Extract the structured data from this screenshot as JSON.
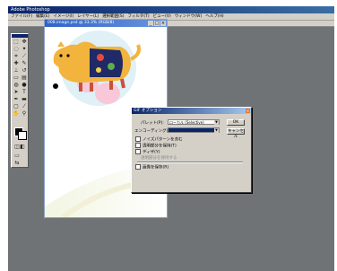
{
  "app": {
    "title": "Adobe Photoshop",
    "menu": [
      "ファイル(F)",
      "編集(E)",
      "イメージ(I)",
      "レイヤー(L)",
      "選択範囲(S)",
      "フィルタ(T)",
      "ビュー(V)",
      "ウィンドウ(W)",
      "ヘルプ(H)"
    ]
  },
  "document": {
    "title": "008.image.psd @ 33.3% (RGB/8)",
    "buttons": [
      "_",
      "□",
      "×"
    ]
  },
  "dialog": {
    "title": "GIF オプション",
    "close": "×",
    "palette_label": "パレット(P):",
    "palette_value": "ローカル (Selective)",
    "encoding_label": "エンコーディング(E):",
    "encoding_value": "",
    "ok_label": "OK",
    "cancel_label": "キャンセル",
    "options": [
      {
        "label": "ノイズパターンを含む",
        "checked": false,
        "disabled": false
      },
      {
        "label": "透明部分を保持(T)",
        "checked": false,
        "disabled": false
      },
      {
        "label": "ディザ(Y)",
        "checked": false,
        "disabled": false
      },
      {
        "label": "透明部分を保持する",
        "checked": false,
        "disabled": true
      },
      {
        "label": "画像を保存(R)",
        "checked": false,
        "disabled": false
      }
    ]
  },
  "colors": {
    "workspace": "#707376",
    "tiger_body": "#f2b43c",
    "tiger_dark": "#c8503c",
    "circle_bg": "#dff0f6"
  }
}
